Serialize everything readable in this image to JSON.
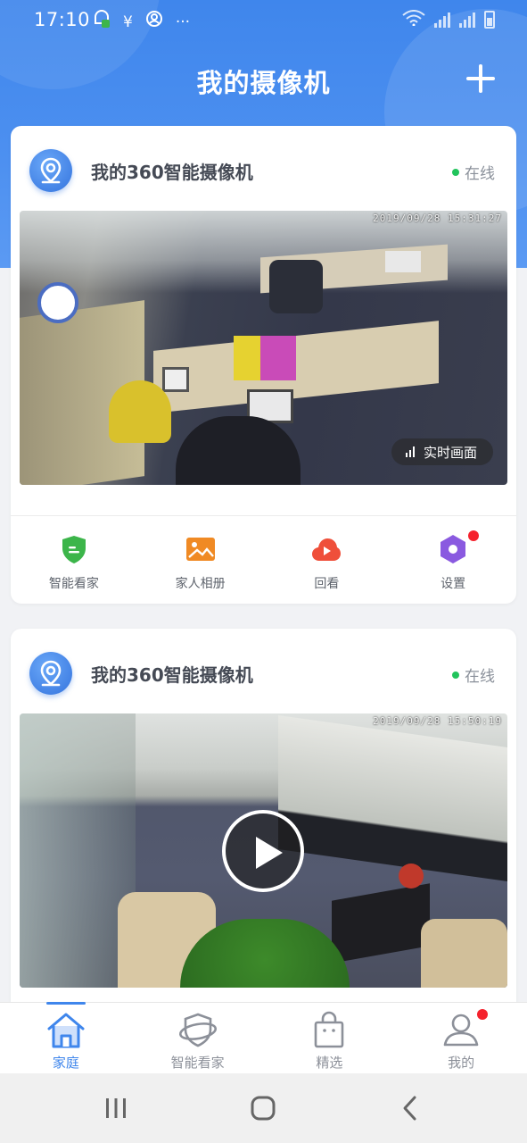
{
  "status_bar": {
    "time": "17:10",
    "icons_left": [
      "notification-app-icon",
      "yen-icon",
      "account-icon",
      "more-icon"
    ],
    "more_text": "···",
    "signal_label": "R"
  },
  "header": {
    "title": "我的摄像机"
  },
  "cameras": [
    {
      "name": "我的360智能摄像机",
      "status": "在线",
      "timestamp": "2019/09/28 15:31:27",
      "live_label": "实时画面"
    },
    {
      "name": "我的360智能摄像机",
      "status": "在线",
      "timestamp": "2019/09/28 15:50:19"
    }
  ],
  "actions": [
    {
      "label": "智能看家",
      "icon": "shield-icon",
      "color": "#3cb54a"
    },
    {
      "label": "家人相册",
      "icon": "photo-icon",
      "color": "#f08a24"
    },
    {
      "label": "回看",
      "icon": "cloud-play-icon",
      "color": "#ef4f3a"
    },
    {
      "label": "设置",
      "icon": "settings-hexagon-icon",
      "color": "#8a5ae0",
      "badge": true
    }
  ],
  "tabs": [
    {
      "label": "家庭",
      "icon": "home-icon",
      "active": true
    },
    {
      "label": "智能看家",
      "icon": "shield-ring-icon",
      "active": false
    },
    {
      "label": "精选",
      "icon": "shopping-bag-icon",
      "active": false
    },
    {
      "label": "我的",
      "icon": "user-icon",
      "active": false,
      "badge": true
    }
  ],
  "colors": {
    "primary": "#3f86ec",
    "online_dot": "#21c45c",
    "badge": "#f5222d"
  }
}
